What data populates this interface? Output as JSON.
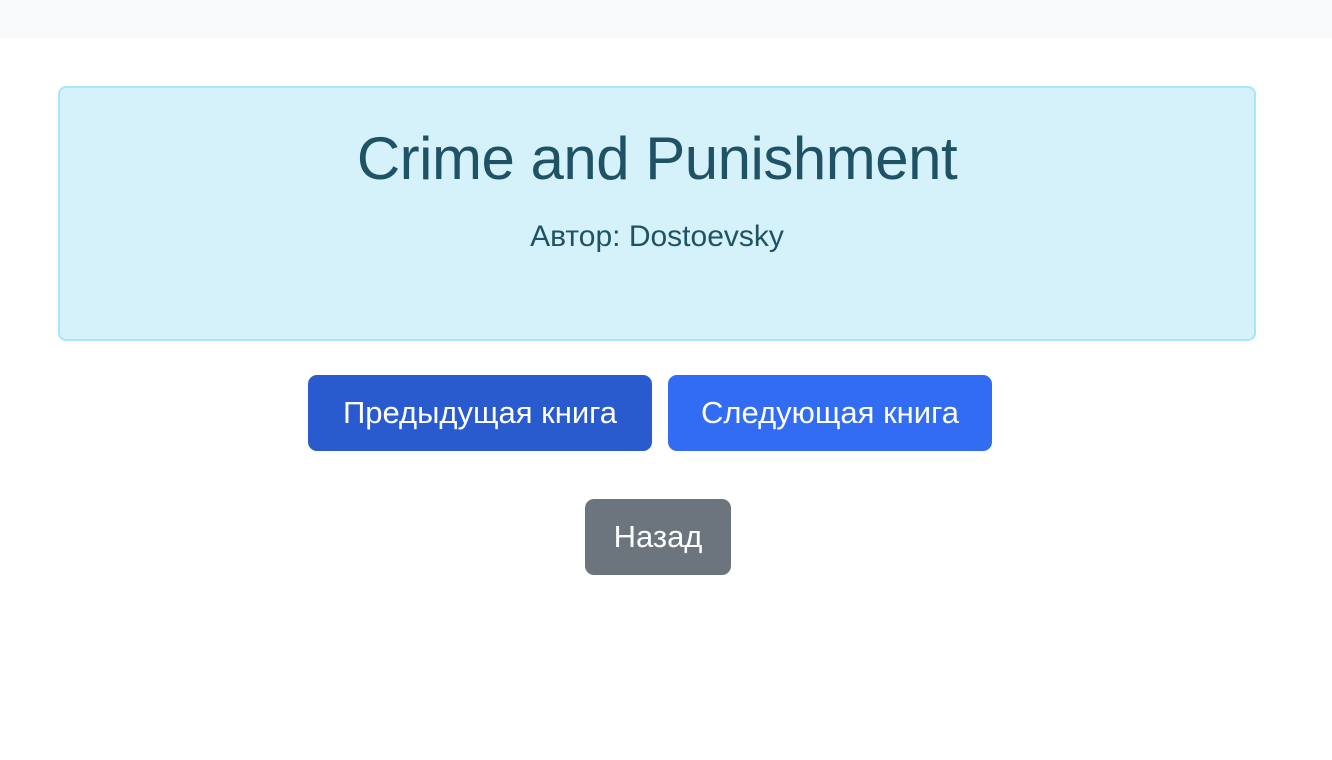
{
  "book": {
    "title": "Crime and Punishment",
    "author_line": "Автор: Dostoevsky"
  },
  "navigation": {
    "prev_label": "Предыдущая книга",
    "next_label": "Следующая книга",
    "back_label": "Назад"
  },
  "colors": {
    "card_background": "#d5f2fa",
    "card_border": "#a6e6f6",
    "card_text": "#1f5265",
    "prev_button": "#2a5bce",
    "next_button": "#316cf2",
    "back_button": "#6c757d"
  }
}
